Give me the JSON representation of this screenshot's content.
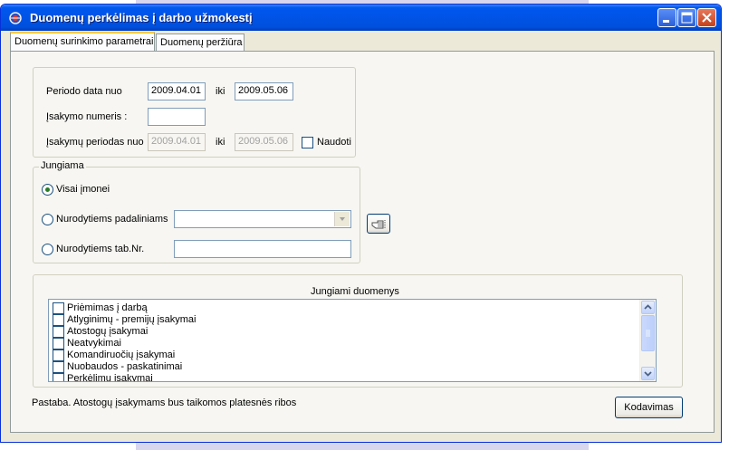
{
  "window": {
    "title": "Duomenų perkėlimas į darbo užmokestį"
  },
  "tabs": [
    {
      "label": "Duomenų surinkimo parametrai",
      "active": true
    },
    {
      "label": "Duomenų peržiūra",
      "active": false
    }
  ],
  "period": {
    "date_label": "Periodo data nuo",
    "date_from": "2009.04.01",
    "to_label": "iki",
    "date_to": "2009.05.06",
    "order_number_label": "Įsakymo numeris :",
    "order_number": "",
    "orders_period_label": "Įsakymų periodas nuo",
    "orders_from": "2009.04.01",
    "orders_to_label": "iki",
    "orders_to": "2009.05.06",
    "use_label": "Naudoti",
    "use_checked": false
  },
  "scope": {
    "legend": "Jungiama",
    "option_all": "Visai įmonei",
    "option_departments": "Nurodytiems padaliniams",
    "option_tabnr": "Nurodytiems tab.Nr.",
    "selected": "option_all",
    "departments_value": "",
    "tabnr_value": ""
  },
  "data_section": {
    "title": "Jungiami  duomenys",
    "items": [
      {
        "label": "Priėmimas į darbą",
        "checked": false
      },
      {
        "label": "Atlyginimų - premijų įsakymai",
        "checked": false
      },
      {
        "label": "Atostogų įsakymai",
        "checked": false
      },
      {
        "label": "Neatvykimai",
        "checked": false
      },
      {
        "label": "Komandiruočių įsakymai",
        "checked": false
      },
      {
        "label": "Nuobaudos - paskatinimai",
        "checked": false
      },
      {
        "label": "Perkėlimų įsakymai",
        "checked": false
      }
    ]
  },
  "note": "Pastaba.  Atostogų įsakymams bus taikomos platesnės ribos",
  "buttons": {
    "encode": "Kodavimas"
  },
  "colors": {
    "titlebar": "#0054e3",
    "window_bg": "#ece9d8",
    "panel_bg": "#f7f6f2",
    "field_border": "#7f9db9"
  },
  "icons": {
    "app": "app-icon",
    "minimize": "minimize-icon",
    "maximize": "maximize-icon",
    "close": "close-icon",
    "pick": "pointing-hand-icon"
  }
}
